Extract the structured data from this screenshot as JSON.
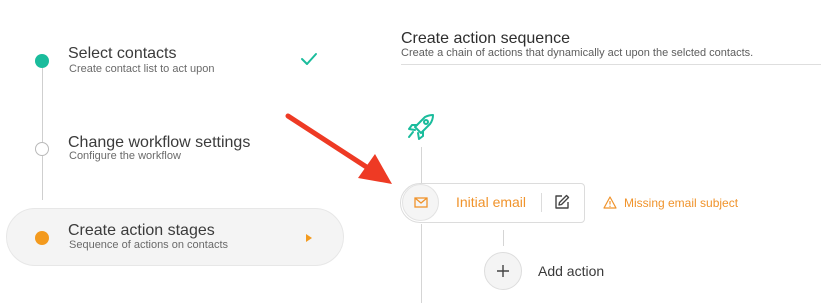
{
  "steps": [
    {
      "title": "Select contacts",
      "subtitle": "Create contact list to act upon",
      "status": "done",
      "icon": "check-icon"
    },
    {
      "title": "Change workflow settings",
      "subtitle": "Configure the workflow",
      "status": "todo"
    },
    {
      "title": "Create action stages",
      "subtitle": "Sequence of actions on contacts",
      "status": "active",
      "icon": "caret-right-icon"
    }
  ],
  "header": {
    "title": "Create action sequence",
    "subtitle": "Create a chain of actions that dynamically act upon the selcted contacts."
  },
  "sequence": {
    "start_icon": "rocket-icon",
    "node": {
      "label": "Initial email",
      "icon": "envelope-icon",
      "edit_icon": "edit-icon",
      "warning": "Missing email subject",
      "warning_icon": "warning-icon"
    },
    "add_action_label": "Add action"
  },
  "annotation": {
    "type": "arrow",
    "color": "#ee3a24"
  },
  "colors": {
    "accent": "#1abc9c",
    "orange": "#f0932b",
    "active_dot": "#f39a1e"
  }
}
